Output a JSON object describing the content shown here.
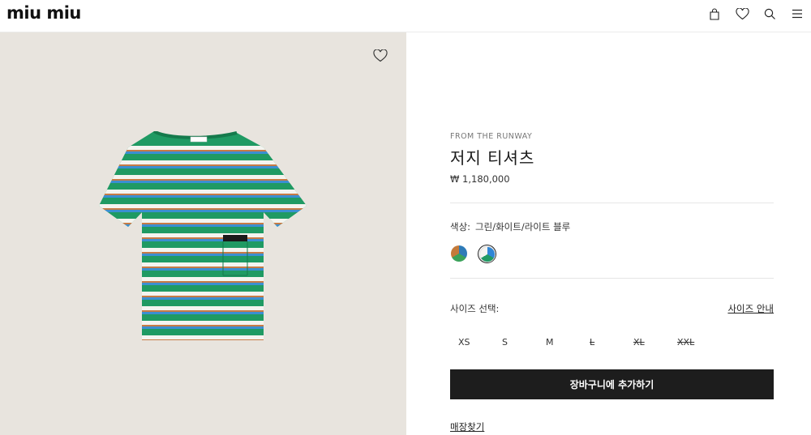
{
  "header": {
    "logo": "miu miu",
    "icons": [
      "bag-icon",
      "heart-icon",
      "search-icon",
      "menu-icon"
    ]
  },
  "gallery": {
    "wishlist_icon": "heart-outline-icon",
    "background_color": "#e8e4de",
    "shirt_colors": {
      "green": "#1f9a63",
      "white": "#f4f4f0",
      "blue": "#3b8fd1",
      "orange": "#c77b45"
    }
  },
  "product": {
    "eyebrow": "FROM THE RUNWAY",
    "name": "저지 티셔츠",
    "price": "₩ 1,180,000",
    "color_label": "색상:",
    "color_value": "그린/화이트/라이트 블루",
    "swatches": [
      {
        "name": "multicolor-swatch",
        "selected": false
      },
      {
        "name": "green-white-blue-swatch",
        "selected": true
      }
    ],
    "size_label": "사이즈 선택:",
    "size_guide": "사이즈 안내",
    "sizes": [
      {
        "label": "XS",
        "available": true
      },
      {
        "label": "S",
        "available": true
      },
      {
        "label": "M",
        "available": true
      },
      {
        "label": "L",
        "available": false
      },
      {
        "label": "XL",
        "available": false
      },
      {
        "label": "XXL",
        "available": false
      }
    ],
    "add_to_cart": "장바구니에 추가하기",
    "find_store": "매장찾기"
  }
}
